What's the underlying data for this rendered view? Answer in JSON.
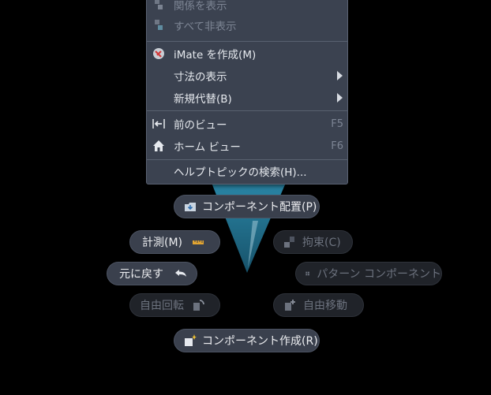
{
  "menu": {
    "items": [
      {
        "label": "関係を表示",
        "disabled": true,
        "icon": "show-relations-icon"
      },
      {
        "label": "すべて非表示",
        "disabled": true,
        "icon": "hide-all-icon"
      },
      {
        "label": "iMate を作成(M)",
        "icon": "imate-icon"
      },
      {
        "label": "寸法の表示",
        "submenu": true
      },
      {
        "label": "新規代替(B)",
        "submenu": true
      },
      {
        "label": "前のビュー",
        "shortcut": "F5",
        "icon": "previous-view-icon"
      },
      {
        "label": "ホーム ビュー",
        "shortcut": "F6",
        "icon": "home-icon"
      },
      {
        "label": "ヘルプトピックの検索(H)..."
      }
    ]
  },
  "marking_menu": {
    "place_component": "コンポーネント配置(P)",
    "measure": "計測(M)",
    "constrain": "拘束(C)",
    "undo": "元に戻す",
    "pattern_component": "パターン コンポーネント",
    "free_rotate": "自由回転",
    "free_move": "自由移動",
    "create_component": "コンポーネント作成(R)"
  },
  "colors": {
    "menu_bg": "#3b4250",
    "pill_bg": "#3a404d",
    "pill_disabled_bg": "#202329",
    "cone": "#1f6f8a"
  }
}
